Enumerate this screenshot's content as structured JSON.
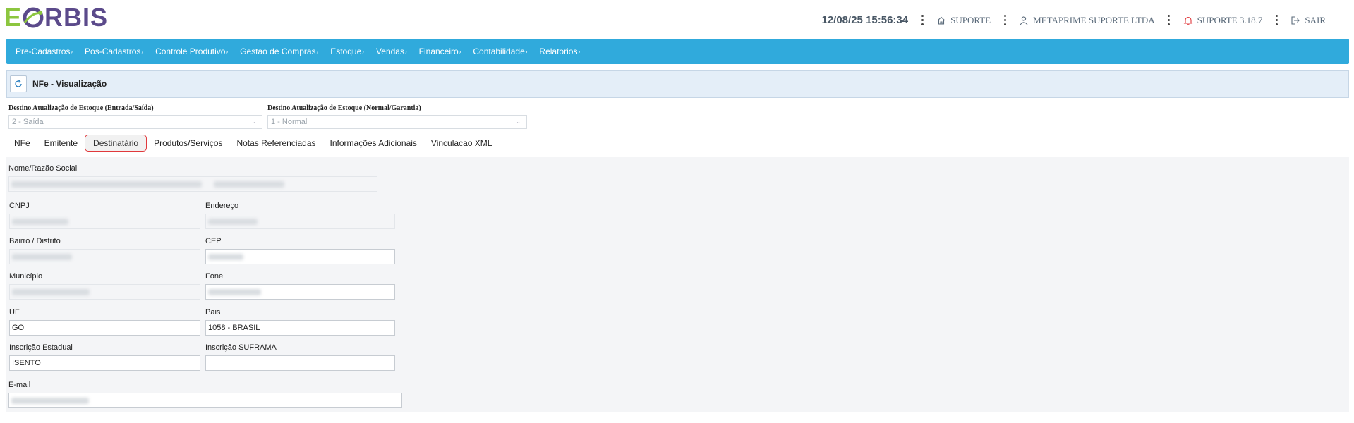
{
  "header": {
    "logo_first": "E",
    "logo_rest": "RBIS",
    "datetime": "12/08/25 15:56:34",
    "support": "SUPORTE",
    "company": "METAPRIME SUPORTE LTDA",
    "version": "SUPORTE 3.18.7",
    "logout": "SAIR"
  },
  "menu": {
    "items": [
      {
        "label": "Pre-Cadastros"
      },
      {
        "label": "Pos-Cadastros"
      },
      {
        "label": "Controle Produtivo"
      },
      {
        "label": "Gestao de Compras"
      },
      {
        "label": "Estoque"
      },
      {
        "label": "Vendas"
      },
      {
        "label": "Financeiro"
      },
      {
        "label": "Contabilidade"
      },
      {
        "label": "Relatorios"
      }
    ],
    "caret": "›"
  },
  "page": {
    "title": "NFe - Visualização"
  },
  "destino": {
    "entrada_saida": {
      "label": "Destino Atualização de Estoque (Entrada/Saída)",
      "value": "2 - Saída"
    },
    "normal_garantia": {
      "label": "Destino Atualização de Estoque (Normal/Garantia)",
      "value": "1 - Normal"
    }
  },
  "tabs": [
    {
      "label": "NFe",
      "active": false
    },
    {
      "label": "Emitente",
      "active": false
    },
    {
      "label": "Destinatário",
      "active": true
    },
    {
      "label": "Produtos/Serviços",
      "active": false
    },
    {
      "label": "Notas Referenciadas",
      "active": false
    },
    {
      "label": "Informações Adicionais",
      "active": false
    },
    {
      "label": "Vinculacao XML",
      "active": false
    }
  ],
  "form": {
    "nome": {
      "label": "Nome/Razão Social"
    },
    "cnpj": {
      "label": "CNPJ"
    },
    "endereco": {
      "label": "Endereço"
    },
    "bairro": {
      "label": "Bairro / Distrito"
    },
    "cep": {
      "label": "CEP"
    },
    "municipio": {
      "label": "Município"
    },
    "fone": {
      "label": "Fone"
    },
    "uf": {
      "label": "UF",
      "value": "GO"
    },
    "pais": {
      "label": "Pais",
      "value": "1058 - BRASIL"
    },
    "inscricao_estadual": {
      "label": "Inscrição Estadual",
      "value": "ISENTO"
    },
    "inscricao_suframa": {
      "label": "Inscrição SUFRAMA",
      "value": ""
    },
    "email": {
      "label": "E-mail"
    }
  },
  "colors": {
    "menubar": "#30aadc",
    "logo_green": "#8cc63f",
    "logo_purple": "#5b4a8b",
    "active_tab_border": "#e0393c",
    "title_bg": "#e4eef8"
  },
  "icons": [
    "home-icon",
    "user-icon",
    "bell-icon",
    "logout-icon",
    "refresh-icon",
    "kebab-icon"
  ]
}
